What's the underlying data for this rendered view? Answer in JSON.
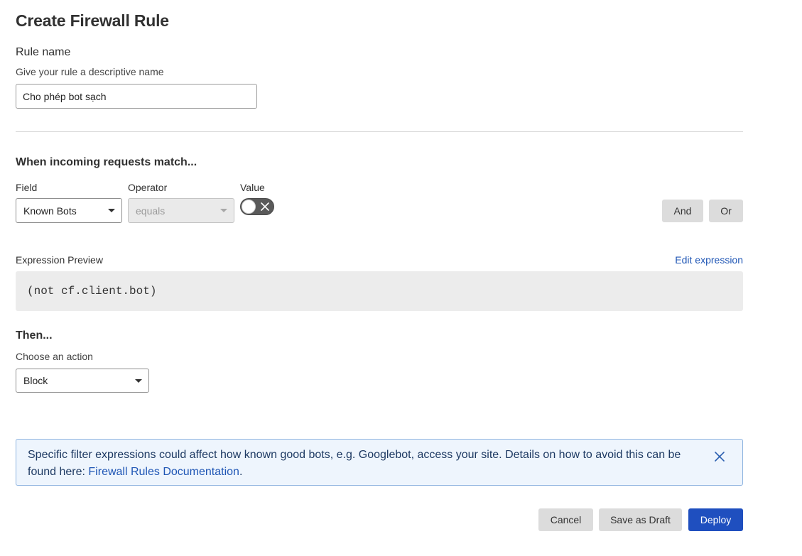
{
  "page": {
    "title": "Create Firewall Rule"
  },
  "rule_name": {
    "label": "Rule name",
    "hint": "Give your rule a descriptive name",
    "value": "Cho phép bot sạch"
  },
  "match": {
    "heading": "When incoming requests match...",
    "field_label": "Field",
    "operator_label": "Operator",
    "value_label": "Value",
    "field_value": "Known Bots",
    "operator_value": "equals",
    "toggle_on": false,
    "and_label": "And",
    "or_label": "Or"
  },
  "expression": {
    "label": "Expression Preview",
    "edit_link": "Edit expression",
    "code": "(not cf.client.bot)"
  },
  "then": {
    "heading": "Then...",
    "hint": "Choose an action",
    "action_value": "Block"
  },
  "banner": {
    "text": "Specific filter expressions could affect how known good bots, e.g. Googlebot, access your site. Details on how to avoid this can be found here: ",
    "link": "Firewall Rules Documentation",
    "trailing": "."
  },
  "footer": {
    "cancel_label": "Cancel",
    "draft_label": "Save as Draft",
    "deploy_label": "Deploy"
  },
  "colors": {
    "primary": "#1f4fbf",
    "link": "#1f56b5",
    "banner_bg": "#eef5fd",
    "banner_border": "#8fb4e0"
  },
  "icons": {
    "toggle": "x-icon",
    "banner_close": "close-icon",
    "select_caret": "caret-down-icon"
  }
}
